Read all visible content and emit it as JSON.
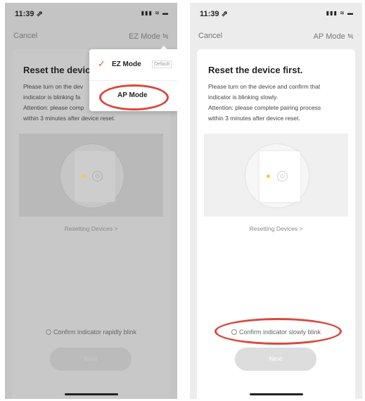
{
  "left": {
    "status": {
      "time": "11:39 ⇗",
      "icons": "▮▮▮ ≋ ▬"
    },
    "nav": {
      "cancel": "Cancel",
      "mode": "EZ Mode ≒"
    },
    "card": {
      "title": "Reset the device",
      "desc_lines": [
        "Please turn on the dev",
        "indicator is blinking fa",
        "Attention: please comp",
        "within 3 minutes after device reset."
      ]
    },
    "resetting": "Resetting Devices >",
    "confirm": "Confirm indicator rapidly blink",
    "next": "Next",
    "dropdown": {
      "ez_label": "EZ Mode",
      "ez_badge": "Default",
      "ap_label": "AP Mode"
    }
  },
  "right": {
    "status": {
      "time": "11:39 ⇗",
      "icons": "▮▮▮ ≋ ▬"
    },
    "nav": {
      "cancel": "Cancel",
      "mode": "AP Mode ≒"
    },
    "card": {
      "title": "Reset the device first.",
      "desc_lines": [
        "Please turn on the device and confirm that",
        "indicator is blinking slowly.",
        "Attention: please complete pairing process",
        "within 3 minutes after device reset."
      ]
    },
    "resetting": "Resetting Devices >",
    "confirm": "Confirm indicator slowly blink",
    "next": "Next"
  },
  "colors": {
    "highlight_ring": "#d9483c",
    "check": "#e55040",
    "indicator": "#f0cf3a"
  }
}
